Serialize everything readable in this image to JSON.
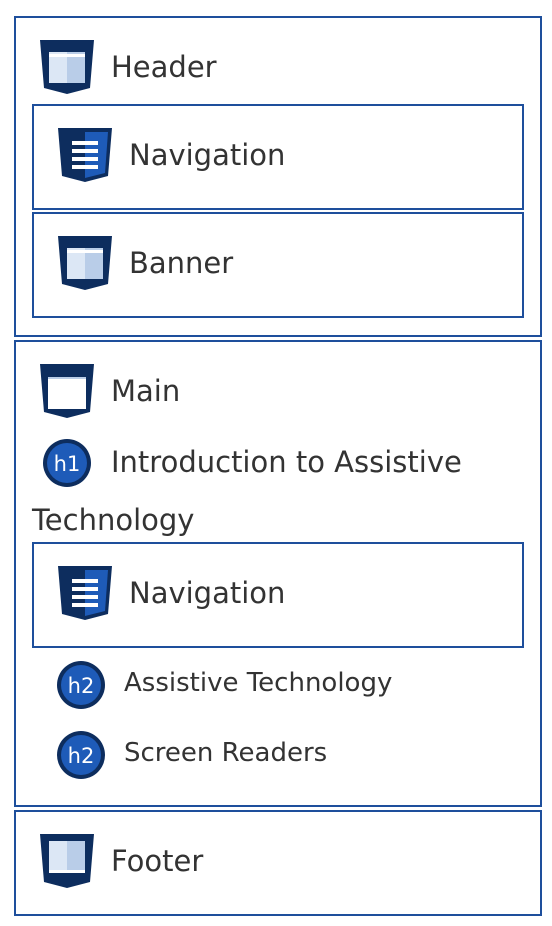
{
  "colors": {
    "border": "#1e4f9c",
    "shield_dark": "#0d2d5e",
    "shield_mid": "#1e5bb8",
    "shield_light": "#b9cde8",
    "badge_fill": "#1e5bb8",
    "badge_ring": "#0d2d5e"
  },
  "header": {
    "label": "Header",
    "icon": "header-landmark-icon",
    "navigation": {
      "label": "Navigation",
      "icon": "navigation-landmark-icon"
    },
    "banner": {
      "label": "Banner",
      "icon": "banner-landmark-icon"
    }
  },
  "main": {
    "label": "Main",
    "icon": "main-landmark-icon",
    "h1": {
      "badge": "h1",
      "text": "Introduction to Assistive Technology"
    },
    "navigation": {
      "label": "Navigation",
      "icon": "navigation-landmark-icon"
    },
    "h2_items": [
      {
        "badge": "h2",
        "text": "Assistive Technology"
      },
      {
        "badge": "h2",
        "text": "Screen Readers"
      }
    ]
  },
  "footer": {
    "label": "Footer",
    "icon": "footer-landmark-icon"
  }
}
